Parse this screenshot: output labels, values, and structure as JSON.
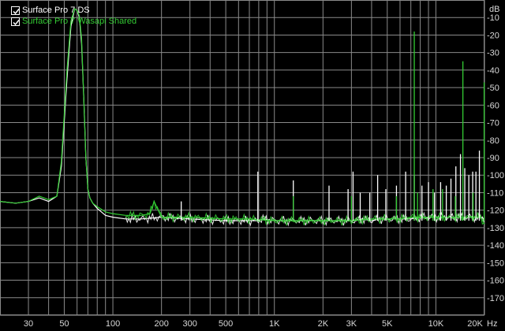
{
  "colors": {
    "background": "#000000",
    "grid": "#8a8a8a",
    "text": "#d8d8d8",
    "series_white": "#ffffff",
    "series_green": "#33cc33"
  },
  "legend": {
    "items": [
      {
        "label": "Surface Pro 7 DS",
        "color": "#ffffff",
        "checked": true
      },
      {
        "label": "Surface Pro 7 Wasapi Shared",
        "color": "#33cc33",
        "checked": true
      }
    ]
  },
  "chart_data": {
    "type": "line",
    "title": "",
    "xlabel": "Hz",
    "ylabel": "dB",
    "x_scale": "log",
    "xlim": [
      20,
      20000
    ],
    "ylim": [
      -180,
      0
    ],
    "grid": true,
    "legend_position": "top-left",
    "x_tick_labels": [
      {
        "value": 30,
        "label": "30"
      },
      {
        "value": 50,
        "label": "50"
      },
      {
        "value": 100,
        "label": "100"
      },
      {
        "value": 200,
        "label": "200"
      },
      {
        "value": 300,
        "label": "300"
      },
      {
        "value": 500,
        "label": "500"
      },
      {
        "value": 1000,
        "label": "1K"
      },
      {
        "value": 2000,
        "label": "2K"
      },
      {
        "value": 3000,
        "label": "3K"
      },
      {
        "value": 5000,
        "label": "5K"
      },
      {
        "value": 10000,
        "label": "10K"
      },
      {
        "value": 20000,
        "label": "20K"
      }
    ],
    "x_unit_label": "Hz",
    "y_tick_labels": [
      "-10",
      "-20",
      "-30",
      "-40",
      "-50",
      "-60",
      "-70",
      "-80",
      "-90",
      "-100",
      "-110",
      "-120",
      "-130",
      "-140",
      "-150",
      "-160",
      "-170"
    ],
    "y_unit_label": "dB",
    "series": [
      {
        "name": "Surface Pro 7 DS",
        "color": "#ffffff",
        "x": [
          20,
          25,
          30,
          35,
          40,
          45,
          48,
          52,
          55,
          58,
          60,
          62,
          64,
          66,
          68,
          70,
          72,
          75,
          80,
          90,
          100,
          120,
          150,
          200,
          300,
          500,
          700,
          800,
          850,
          1000,
          1500,
          2000,
          2100,
          2200,
          2500,
          3000,
          3200,
          3500,
          4000,
          4500,
          5000,
          6000,
          7000,
          8000,
          9000,
          10000,
          11000,
          12000,
          13000,
          14000,
          15000,
          16000,
          17000,
          18000,
          19000,
          20000
        ],
        "y": [
          -115,
          -116,
          -115,
          -113,
          -115,
          -112,
          -95,
          -45,
          -15,
          -5,
          -6,
          -10,
          -25,
          -55,
          -90,
          -108,
          -113,
          -116,
          -119,
          -123,
          -124,
          -125,
          -125,
          -124,
          -125,
          -126,
          -126,
          -126,
          -125,
          -126,
          -126,
          -126,
          -126,
          -126,
          -126,
          -126,
          -126,
          -125,
          -126,
          -125,
          -125,
          -125,
          -125,
          -124,
          -124,
          -124,
          -124,
          -124,
          -124,
          -124,
          -124,
          -124,
          -124,
          -124,
          -124,
          -125
        ]
      },
      {
        "name": "Surface Pro 7 Wasapi Shared",
        "color": "#33cc33",
        "x": [
          20,
          25,
          30,
          35,
          40,
          45,
          48,
          52,
          55,
          58,
          60,
          62,
          64,
          66,
          68,
          70,
          72,
          75,
          80,
          90,
          100,
          120,
          150,
          170,
          180,
          200,
          300,
          500,
          700,
          1000,
          1500,
          2000,
          3000,
          4000,
          5000,
          6000,
          7000,
          8000,
          9000,
          10000,
          12000,
          14000,
          16000,
          18000,
          19000,
          20000
        ],
        "y": [
          -115,
          -116,
          -115,
          -112,
          -114,
          -112,
          -92,
          -40,
          -12,
          -5,
          -6,
          -9,
          -22,
          -55,
          -90,
          -108,
          -113,
          -116,
          -118,
          -121,
          -122,
          -123,
          -123,
          -122,
          -115,
          -124,
          -124,
          -125,
          -125,
          -126,
          -126,
          -126,
          -126,
          -125,
          -125,
          -125,
          -124,
          -124,
          -124,
          -124,
          -124,
          -124,
          -124,
          -124,
          -124,
          -128
        ]
      }
    ],
    "spurs": [
      {
        "series": 0,
        "x": 265,
        "y": -115
      },
      {
        "series": 0,
        "x": 790,
        "y": -98
      },
      {
        "series": 0,
        "x": 1310,
        "y": -103
      },
      {
        "series": 0,
        "x": 2180,
        "y": -106
      },
      {
        "series": 0,
        "x": 2860,
        "y": -108
      },
      {
        "series": 0,
        "x": 3070,
        "y": -98
      },
      {
        "series": 0,
        "x": 3400,
        "y": -110
      },
      {
        "series": 0,
        "x": 3900,
        "y": -110
      },
      {
        "series": 0,
        "x": 4360,
        "y": -100
      },
      {
        "series": 0,
        "x": 4900,
        "y": -108
      },
      {
        "series": 0,
        "x": 5700,
        "y": -106
      },
      {
        "series": 0,
        "x": 6500,
        "y": -98
      },
      {
        "series": 0,
        "x": 7350,
        "y": -100
      },
      {
        "series": 0,
        "x": 8200,
        "y": -106
      },
      {
        "series": 0,
        "x": 9000,
        "y": -104
      },
      {
        "series": 0,
        "x": 9800,
        "y": -110
      },
      {
        "series": 0,
        "x": 10700,
        "y": -104
      },
      {
        "series": 0,
        "x": 11600,
        "y": -106
      },
      {
        "series": 0,
        "x": 12400,
        "y": -102
      },
      {
        "series": 0,
        "x": 13300,
        "y": -95
      },
      {
        "series": 0,
        "x": 14200,
        "y": -88
      },
      {
        "series": 0,
        "x": 15100,
        "y": -96
      },
      {
        "series": 0,
        "x": 16000,
        "y": -100
      },
      {
        "series": 0,
        "x": 16900,
        "y": -98
      },
      {
        "series": 0,
        "x": 17700,
        "y": -98
      },
      {
        "series": 0,
        "x": 18600,
        "y": -86
      },
      {
        "series": 1,
        "x": 1310,
        "y": -112
      },
      {
        "series": 1,
        "x": 3000,
        "y": -112
      },
      {
        "series": 1,
        "x": 5700,
        "y": -112
      },
      {
        "series": 1,
        "x": 7350,
        "y": -18
      },
      {
        "series": 1,
        "x": 7700,
        "y": -110
      },
      {
        "series": 1,
        "x": 9600,
        "y": -108
      },
      {
        "series": 1,
        "x": 11000,
        "y": -108
      },
      {
        "series": 1,
        "x": 13200,
        "y": -112
      },
      {
        "series": 1,
        "x": 14700,
        "y": -35
      },
      {
        "series": 1,
        "x": 17000,
        "y": -110
      },
      {
        "series": 1,
        "x": 19900,
        "y": -47
      }
    ]
  }
}
